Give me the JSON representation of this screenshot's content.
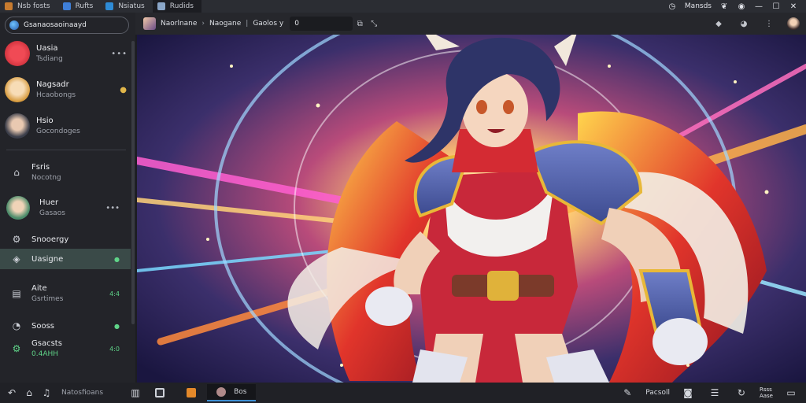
{
  "tabbar": {
    "tabs": [
      {
        "label": "Nsb fosts",
        "color": "#c77b2f"
      },
      {
        "label": "Rufts",
        "color": "#3f7fd8"
      },
      {
        "label": "Nsiatus",
        "color": "#2e8bd6"
      },
      {
        "label": "Rudids",
        "color": "#8aa6c8"
      }
    ],
    "right_label": "Mansds",
    "icons": [
      "clock-icon",
      "leaf-icon",
      "globe-icon",
      "minimize-icon",
      "maximize-icon",
      "close-icon"
    ]
  },
  "sidebar": {
    "search_value": "Gsanaosaoinaayd",
    "chats": [
      {
        "name": "Uasia",
        "sub": "Tsdiang",
        "avatar": "#d3323e"
      },
      {
        "name": "Nagsadr",
        "sub": "Hcaobongs",
        "avatar": "#f0c88d"
      },
      {
        "name": "Hsio",
        "sub": "Gocondoges",
        "avatar": "#5a5f6e"
      }
    ],
    "nav": [
      {
        "label": "Fsris",
        "sub": "Nocotng",
        "icon": "home-icon"
      },
      {
        "label": "Huer",
        "sub": "Gasaos",
        "icon": "avatar"
      },
      {
        "label": "Snooergy",
        "icon": "gear-icon"
      },
      {
        "label": "Uasigne",
        "badge": "●",
        "icon": "settings-icon"
      },
      {
        "label": "Aite",
        "sub": "Gsrtimes",
        "badge": "4:4",
        "icon": "note-icon"
      },
      {
        "label": "Sooss",
        "badge": "●",
        "icon": "clock-icon"
      },
      {
        "label": "Gsacsts",
        "sub": "0.4AHH",
        "badge": "4:0",
        "icon": "gear-icon"
      }
    ]
  },
  "toolbar": {
    "crumb_a": "Naorlnane",
    "crumb_b": "Naogane",
    "crumb_c": "Gaolos y",
    "zoom_value": "0"
  },
  "taskbar": {
    "label": "Natosfioans",
    "active_app": "Bos",
    "tray_text": "Pacsoll",
    "clock_line1": "Rsss",
    "clock_line2": "Aase"
  },
  "colors": {
    "accent": "#3c8fd4",
    "active_nav": "#3a4a48",
    "badge_green": "#5fd488"
  }
}
